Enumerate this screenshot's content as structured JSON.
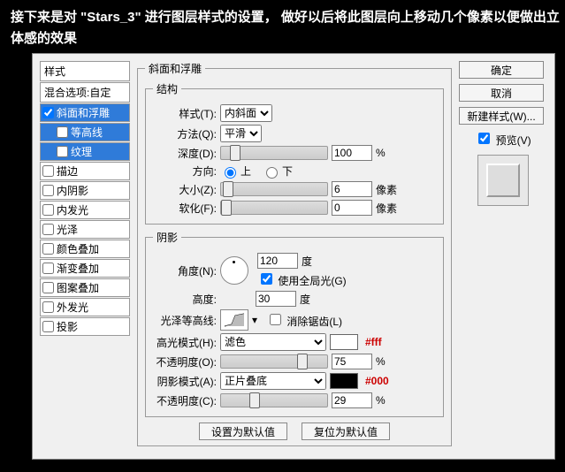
{
  "caption": "接下来是对 \"Stars_3\" 进行图层样式的设置， 做好以后将此图层向上移动几个像素以便做出立体感的效果",
  "styles": {
    "header": "样式",
    "blend": "混合选项:自定",
    "items": [
      {
        "label": "斜面和浮雕",
        "checked": true,
        "selected": true
      },
      {
        "label": "等高线",
        "checked": false,
        "selected": true,
        "child": true
      },
      {
        "label": "纹理",
        "checked": false,
        "selected": true,
        "child": true
      },
      {
        "label": "描边",
        "checked": false
      },
      {
        "label": "内阴影",
        "checked": false
      },
      {
        "label": "内发光",
        "checked": false
      },
      {
        "label": "光泽",
        "checked": false
      },
      {
        "label": "颜色叠加",
        "checked": false
      },
      {
        "label": "渐变叠加",
        "checked": false
      },
      {
        "label": "图案叠加",
        "checked": false
      },
      {
        "label": "外发光",
        "checked": false
      },
      {
        "label": "投影",
        "checked": false
      }
    ]
  },
  "panel": {
    "title": "斜面和浮雕",
    "structure": {
      "legend": "结构",
      "style_l": "样式(T):",
      "style_v": "内斜面",
      "tech_l": "方法(Q):",
      "tech_v": "平滑",
      "depth_l": "深度(D):",
      "depth_v": "100",
      "pct": "%",
      "dir_l": "方向:",
      "up": "上",
      "down": "下",
      "size_l": "大小(Z):",
      "size_v": "6",
      "px": "像素",
      "soft_l": "软化(F):",
      "soft_v": "0"
    },
    "shading": {
      "legend": "阴影",
      "angle_l": "角度(N):",
      "angle_v": "120",
      "deg": "度",
      "global_l": "使用全局光(G)",
      "alt_l": "高度:",
      "alt_v": "30",
      "gloss_l": "光泽等高线:",
      "aa_l": "消除锯齿(L)",
      "hi_mode_l": "高光模式(H):",
      "hi_mode_v": "滤色",
      "hi_color": "#ffffff",
      "hi_annot": "#fff",
      "hi_op_l": "不透明度(O):",
      "hi_op_v": "75",
      "sh_mode_l": "阴影模式(A):",
      "sh_mode_v": "正片叠底",
      "sh_color": "#000000",
      "sh_annot": "#000",
      "sh_op_l": "不透明度(C):",
      "sh_op_v": "29"
    },
    "btn_default": "设置为默认值",
    "btn_reset": "复位为默认值"
  },
  "right": {
    "ok": "确定",
    "cancel": "取消",
    "new": "新建样式(W)...",
    "preview": "预览(V)"
  }
}
